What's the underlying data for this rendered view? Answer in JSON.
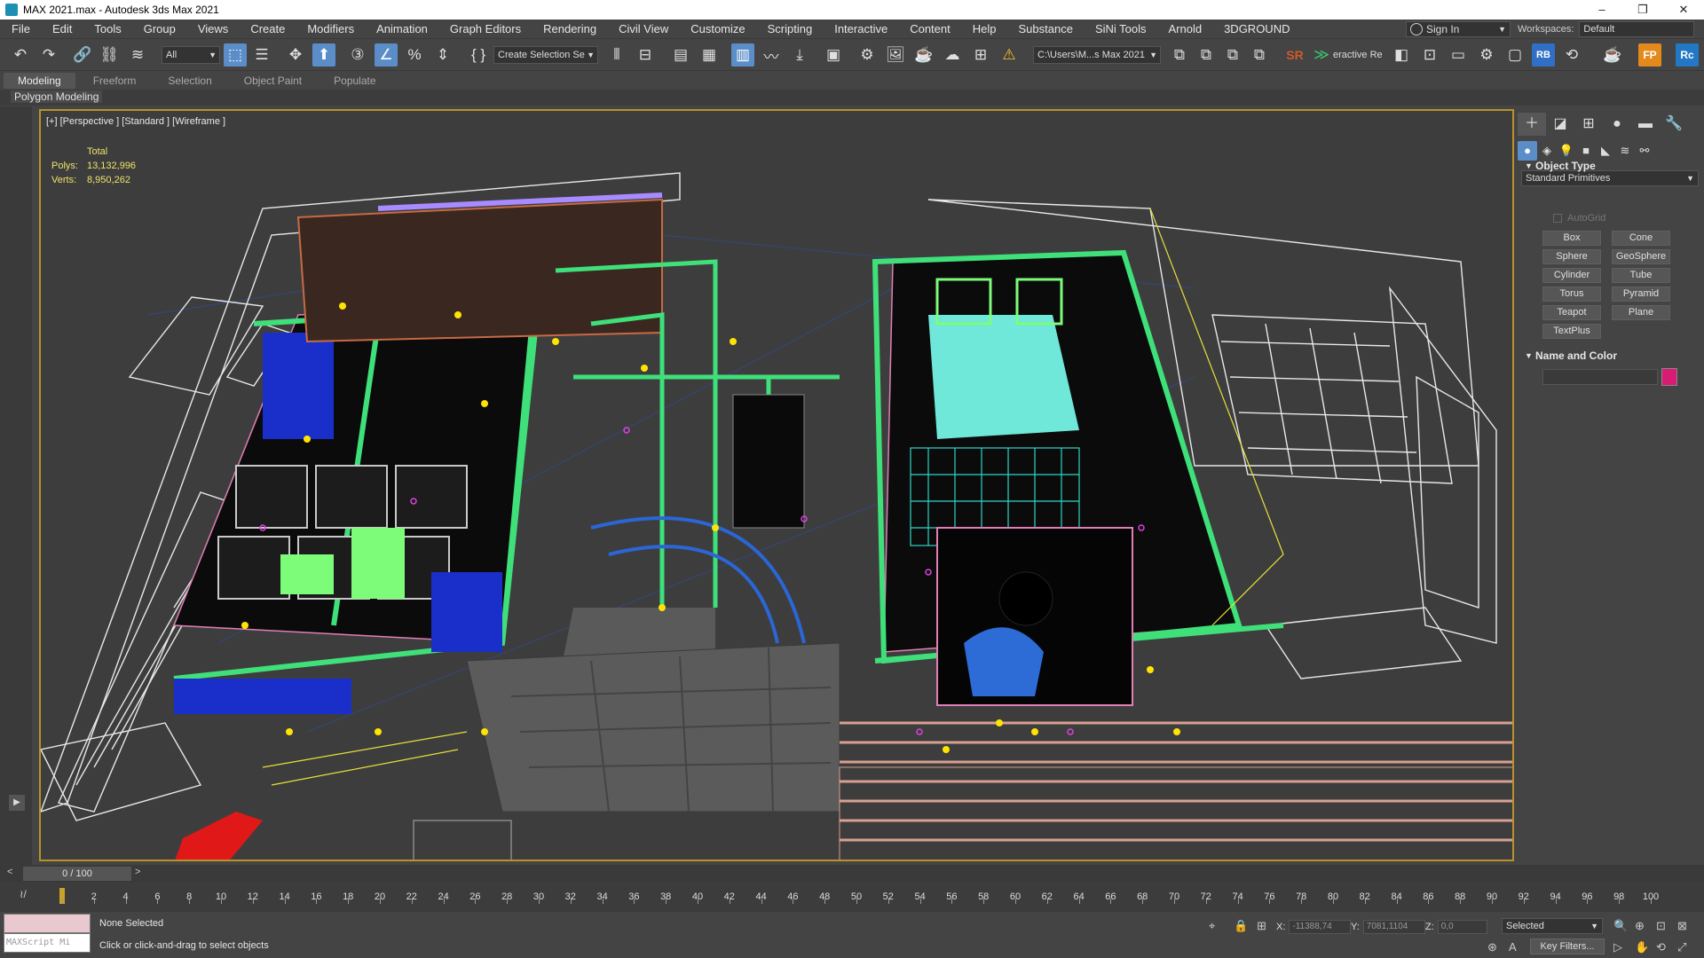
{
  "window": {
    "title": "MAX 2021.max - Autodesk 3ds Max 2021",
    "controls": [
      "–",
      "❐",
      "✕"
    ]
  },
  "menu": [
    "File",
    "Edit",
    "Tools",
    "Group",
    "Views",
    "Create",
    "Modifiers",
    "Animation",
    "Graph Editors",
    "Rendering",
    "Civil View",
    "Customize",
    "Scripting",
    "Interactive",
    "Content",
    "Help",
    "Substance",
    "SiNi Tools",
    "Arnold",
    "3DGROUND"
  ],
  "header": {
    "sign_in": "Sign In",
    "workspaces_label": "Workspaces:",
    "workspace_value": "Default"
  },
  "toolbar": {
    "selection_filter": "All",
    "selection_set": "Create Selection Se",
    "project_path": "C:\\Users\\M...s Max 2021",
    "render_label": "eractive Re",
    "icons": [
      "undo-icon",
      "redo-icon",
      "link-icon",
      "unlink-icon",
      "bind-space-warp-icon",
      "select-object-icon",
      "select-by-name-icon",
      "select-move-icon",
      "select-rotate-icon",
      "snap-3d-icon",
      "angle-snap-icon",
      "percent-snap-icon",
      "spinner-snap-icon",
      "edit-named-sets-icon",
      "mirror-icon",
      "align-icon",
      "layer-explorer-icon",
      "scene-explorer-icon",
      "toggle-ribbon-icon",
      "curve-editor-icon",
      "schematic-view-icon",
      "material-editor-icon",
      "render-setup-icon",
      "rendered-frame-window-icon",
      "render-production-icon",
      "render-iterative-icon",
      "render-online-icon",
      "render-activeshade-icon",
      "warning-icon"
    ]
  },
  "ribbon": {
    "tabs": [
      "Modeling",
      "Freeform",
      "Selection",
      "Object Paint",
      "Populate"
    ],
    "panel_label": "Polygon Modeling"
  },
  "viewport": {
    "label": "[+] [Perspective ] [Standard ] [Wireframe ]",
    "stats_header": "Total",
    "polys_label": "Polys:",
    "polys_value": "13,132,996",
    "verts_label": "Verts:",
    "verts_value": "8,950,262"
  },
  "command_panel": {
    "category": "Standard Primitives",
    "object_type_title": "Object Type",
    "autogrid": "AutoGrid",
    "primitives": [
      "Box",
      "Cone",
      "Sphere",
      "GeoSphere",
      "Cylinder",
      "Tube",
      "Torus",
      "Pyramid",
      "Teapot",
      "Plane",
      "TextPlus"
    ],
    "name_color_title": "Name and Color",
    "object_color": "#d81b73"
  },
  "timeline": {
    "frame_display": "0 / 100",
    "ticks": [
      "0",
      "2",
      "4",
      "6",
      "8",
      "10",
      "12",
      "14",
      "16",
      "18",
      "20",
      "22",
      "24",
      "26",
      "28",
      "30",
      "32",
      "34",
      "36",
      "38",
      "40",
      "42",
      "44",
      "46",
      "48",
      "50",
      "52",
      "54",
      "56",
      "58",
      "60",
      "62",
      "64",
      "66",
      "68",
      "70",
      "72",
      "74",
      "76",
      "78",
      "80",
      "82",
      "84",
      "86",
      "88",
      "90",
      "92",
      "94",
      "96",
      "98",
      "100"
    ]
  },
  "status": {
    "selection": "None Selected",
    "hint": "Click or click-and-drag to select objects",
    "maxscript": "MAXScript Mi",
    "x_label": "X:",
    "x_value": "-11388,74",
    "y_label": "Y:",
    "y_value": "7081,1104",
    "z_label": "Z:",
    "z_value": "0,0",
    "key_mode": "Selected",
    "key_filters": "Key Filters..."
  },
  "colors": {
    "accent": "#5b8ec9",
    "viewport_border": "#b9922a",
    "stats_text": "#f0e36a"
  }
}
